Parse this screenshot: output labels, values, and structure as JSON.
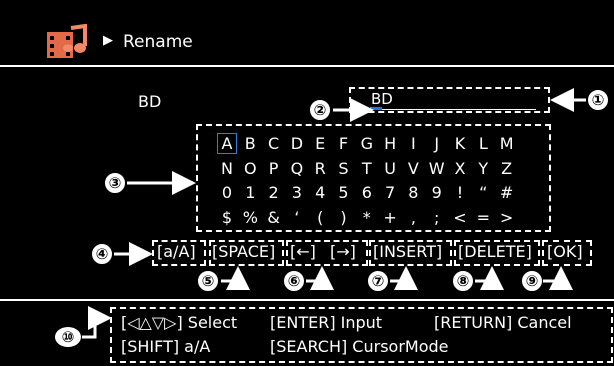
{
  "header": {
    "icon": "film-music-icon",
    "arrow": "▶",
    "title": "Rename"
  },
  "source_name": "BD",
  "input_value": "BD",
  "keyboard": {
    "rows": [
      [
        "A",
        "B",
        "C",
        "D",
        "E",
        "F",
        "G",
        "H",
        "I",
        "J",
        "K",
        "L",
        "M"
      ],
      [
        "N",
        "O",
        "P",
        "Q",
        "R",
        "S",
        "T",
        "U",
        "V",
        "W",
        "X",
        "Y",
        "Z"
      ],
      [
        "0",
        "1",
        "2",
        "3",
        "4",
        "5",
        "6",
        "7",
        "8",
        "9",
        "!",
        "“",
        "#"
      ],
      [
        "$",
        "%",
        "&",
        "‘",
        "(",
        ")",
        "*",
        "+",
        ",",
        ";",
        "<",
        "=",
        ">"
      ]
    ],
    "selected": "A"
  },
  "softkeys": {
    "case": "[a/A]",
    "space": "[SPACE]",
    "left": "[←]",
    "right": "[→]",
    "insert": "[INSERT]",
    "delete": "[DELETE]",
    "ok": "[OK]"
  },
  "help": {
    "line1_a": "[◁△▽▷] Select",
    "line1_b": "[ENTER] Input",
    "line1_c": "[RETURN] Cancel",
    "line2_a": "[SHIFT] a/A",
    "line2_b": "[SEARCH] CursorMode"
  },
  "callouts": [
    "①",
    "②",
    "③",
    "④",
    "⑤",
    "⑥",
    "⑦",
    "⑧",
    "⑨",
    "⑩"
  ]
}
